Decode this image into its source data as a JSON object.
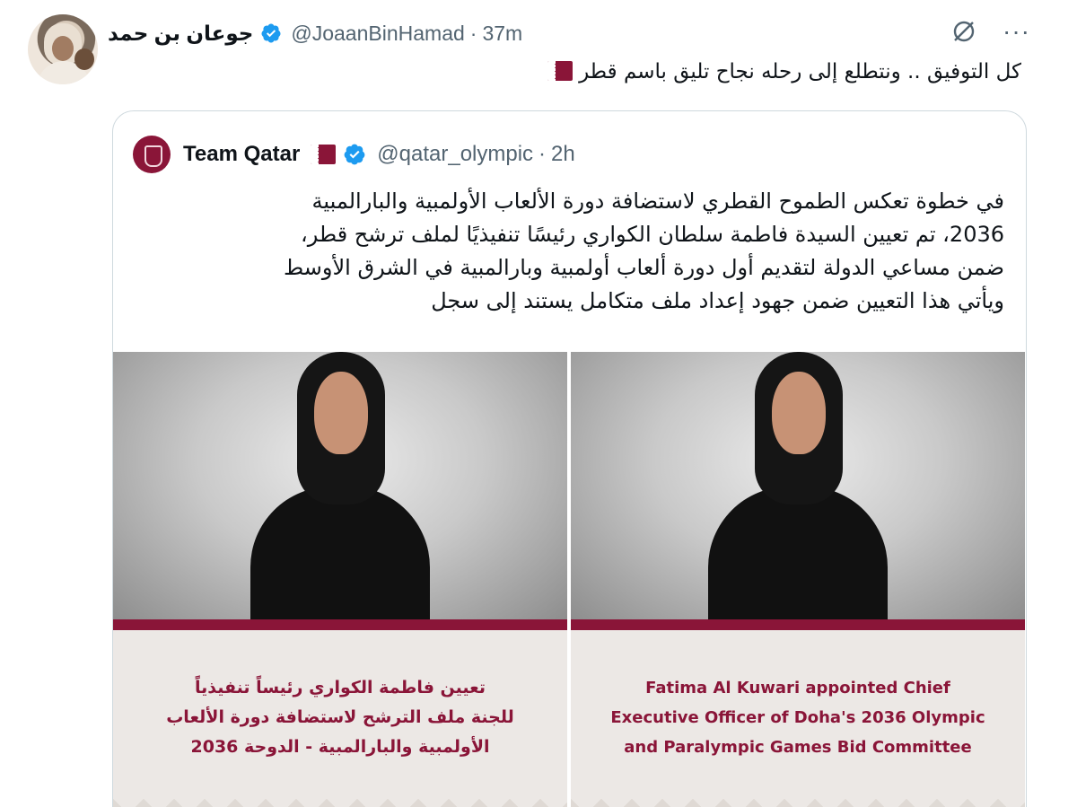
{
  "tweet": {
    "author_name": "جوعان بن حمد",
    "handle": "@JoaanBinHamad",
    "separator": "·",
    "time": "37m",
    "text": "كل التوفيق .. ونتطلع إلى رحله نجاح تليق باسم قطر",
    "flag_icon": "qatar-flag-icon"
  },
  "quoted": {
    "author_name": "Team Qatar",
    "handle": "@qatar_olympic",
    "separator": "·",
    "time": "2h",
    "text_lines": [
      "في خطوة تعكس الطموح القطري لاستضافة دورة الألعاب الأولمبية والبارالمبية",
      "2036، تم تعيين السيدة فاطمة سلطان الكواري رئيسًا تنفيذيًا لملف ترشح قطر،",
      "ضمن مساعي الدولة لتقديم أول دورة ألعاب أولمبية وبارالمبية في الشرق الأوسط",
      "ويأتي هذا التعيين ضمن جهود إعداد ملف متكامل يستند إلى سجل"
    ],
    "images": [
      {
        "caption_lines": [
          "تعيين فاطمة الكواري رئيساً تنفيذياً",
          "للجنة ملف الترشح لاستضافة دورة الألعاب",
          "الأولمبية والبارالمبية - الدوحة 2036"
        ]
      },
      {
        "caption_lines": [
          "Fatima Al Kuwari appointed Chief",
          "Executive Officer of Doha's 2036 Olympic",
          "and Paralympic Games Bid Committee"
        ]
      }
    ]
  },
  "colors": {
    "brand_maroon": "#8a1538",
    "verified_blue": "#1d9bf0",
    "text_primary": "#0f1419",
    "text_secondary": "#536471"
  }
}
